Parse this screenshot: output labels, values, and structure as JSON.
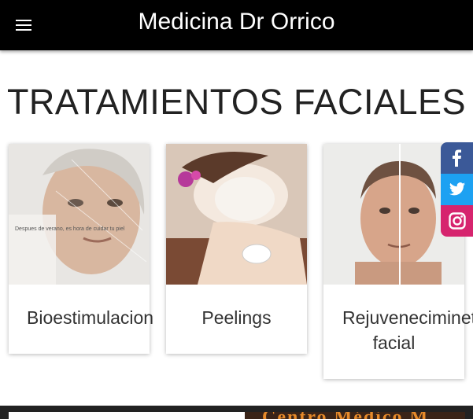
{
  "header": {
    "title": "Medicina Dr Orrico",
    "menu_icon": "hamburger-menu-icon"
  },
  "main": {
    "heading": "TRATAMIENTOS FACIALES",
    "cards": [
      {
        "label": "Bioestimulacion",
        "image_caption": "Despues de verano, es hora de cuidar tu piel"
      },
      {
        "label": "Peelings"
      },
      {
        "label_line1": "Rejuvenecimineto",
        "label_line2": "facial"
      }
    ]
  },
  "social": {
    "facebook_icon": "facebook-icon",
    "twitter_icon": "twitter-icon",
    "instagram_icon": "instagram-icon",
    "colors": {
      "facebook": "#3b5998",
      "twitter": "#1da1f2",
      "instagram": "#d6246e"
    }
  },
  "banner": {
    "text": "Centro Médico M"
  }
}
